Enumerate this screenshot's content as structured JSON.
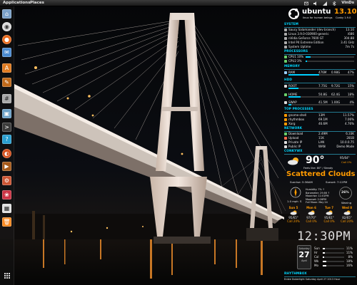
{
  "top_panel": {
    "applications": "Applications",
    "places": "Places",
    "user": "VinDs"
  },
  "launcher": {
    "items": [
      {
        "name": "home-folder-icon",
        "color": "#7aa0c8"
      },
      {
        "name": "chrome-icon",
        "color": "#dddddd"
      },
      {
        "name": "firefox-icon",
        "color": "#e86a1c"
      },
      {
        "name": "email-icon",
        "color": "#4a8ad0"
      },
      {
        "name": "ubuntu-software-center-icon",
        "color": "#e07b20"
      },
      {
        "name": "text-editor-icon",
        "color": "#7a7a7a"
      },
      {
        "name": "calculator-icon",
        "color": "#a9a9a9"
      },
      {
        "name": "image-viewer-icon",
        "color": "#6aa0c8"
      },
      {
        "name": "terminal-icon",
        "color": "#3b3b3b"
      },
      {
        "name": "help-icon",
        "color": "#2a9fd0"
      },
      {
        "name": "ubuntu-one-icon",
        "color": "#d6501c"
      },
      {
        "name": "media-player-icon",
        "color": "#a65a1a"
      },
      {
        "name": "system-settings-icon",
        "color": "#cc5533"
      },
      {
        "name": "photos-icon",
        "color": "#cc3344"
      },
      {
        "name": "calendar-icon",
        "color": "#e0e0e0"
      },
      {
        "name": "trash-icon",
        "color": "#ff8a20"
      }
    ],
    "dash_icon": "dash-grid-icon"
  },
  "conky": {
    "brand": "ubuntu",
    "version": "13.10",
    "tagline": "linux for human beings",
    "conky_ver": "Conky 1.9.0",
    "system": {
      "title": "SYSTEM",
      "rows": [
        {
          "label": "Saucy Salamander (dev branch)",
          "value": "13.10"
        },
        {
          "label": "Linux 3.9.0-030900-generic",
          "value": "i686"
        },
        {
          "label": "nVidia GeForce 7600 GT",
          "value": "304.88"
        },
        {
          "label": "Intel P4 Extreme Edition",
          "value": "3.41 GHz"
        },
        {
          "label": "System Uptime",
          "value": "7m 7s"
        }
      ]
    },
    "processors": {
      "title": "PROCESSORS",
      "rows": [
        {
          "label": "CPU1",
          "pct": "10%",
          "level": 0.1
        },
        {
          "label": "CPU2",
          "pct": "3%",
          "level": 0.03
        }
      ]
    },
    "memory": {
      "title": "MEMORY",
      "rows": [
        {
          "label": "RAM",
          "used": "476M",
          "total": "0.98G",
          "pct": "47%",
          "level": 0.47
        }
      ]
    },
    "hdd": {
      "title": "HDD",
      "rows": [
        {
          "label": "ROOT",
          "used": "7.75G",
          "total": "9.72G",
          "pct": "15%",
          "level": 0.15
        },
        {
          "label": "HOME",
          "used": "50.8G",
          "total": "62.4G",
          "pct": "18%",
          "level": 0.18
        },
        {
          "label": "SWAP",
          "used": "41.5M",
          "total": "1.00G",
          "pct": "4%",
          "level": 0.04
        }
      ]
    },
    "top_processes": {
      "title": "TOP PROCESSES",
      "rows": [
        {
          "label": "gnome-shell",
          "mem": "13M",
          "pct": "11.57%"
        },
        {
          "label": "rhythmbox",
          "mem": "69.1M",
          "pct": "7.06%"
        },
        {
          "label": "Xorg",
          "mem": "46.6M",
          "pct": "4.76%"
        }
      ]
    },
    "network": {
      "title": "NETWORK",
      "rows": [
        {
          "label": "Download",
          "speed": "2.49M",
          "total": "6.33K"
        },
        {
          "label": "Upload",
          "speed": "11K",
          "total": "281B"
        },
        {
          "label": "Private IP",
          "speed": "LAN",
          "total": "10.0.0.75"
        },
        {
          "label": "Public IP",
          "speed": "WAN",
          "total": "Demo Mode"
        }
      ]
    },
    "weather": {
      "title": "CONKYWX",
      "temp": "90°",
      "feels_like": "Feels like: 80° / Steady",
      "hi_lo": "95/64°",
      "chance": "Call 0%",
      "condition": "Scattered Clouds",
      "sunrise": "Sunrise: 5:36AM",
      "sunset": "Sunset: 7:12PM",
      "wind_speed": "1.0 mph",
      "wind_dir": "S",
      "humidity": "Humidity: 7% ↑",
      "barometer": "Barometer: 29.66 ↑",
      "moonrise": "Moonrise: 11:01PM",
      "moonset": "Moonset: 2:28PM",
      "full_moon": "Full Moon: May 24",
      "humidity_pct": "26%",
      "moon_phase": "Waning",
      "forecast": [
        {
          "day": "Sun 5",
          "temp": "95/65°",
          "chance": "Call 20%"
        },
        {
          "day": "Mon 6",
          "temp": "97/70°",
          "chance": "Call 0%"
        },
        {
          "day": "Tue 7",
          "temp": "95/61°",
          "chance": "Call 0%"
        },
        {
          "day": "Wed 8",
          "temp": "82/65°",
          "chance": "Call 20%"
        }
      ]
    },
    "clock": {
      "time": "12:30PM",
      "cal_month": "Saturday",
      "cal_day": "27",
      "cal_dow": "April",
      "stats": [
        {
          "label": "Sun",
          "value": "11%"
        },
        {
          "label": "Hr",
          "value": "11%"
        },
        {
          "label": "Cal",
          "value": "8%"
        },
        {
          "label": "Wk",
          "value": "18%"
        },
        {
          "label": "Mo",
          "value": "16%"
        }
      ]
    },
    "rhythmbox": {
      "title": "RHYTHMBOX",
      "now_playing": "Erdee Doberlight Saturday April 27 2013 Hour"
    }
  }
}
